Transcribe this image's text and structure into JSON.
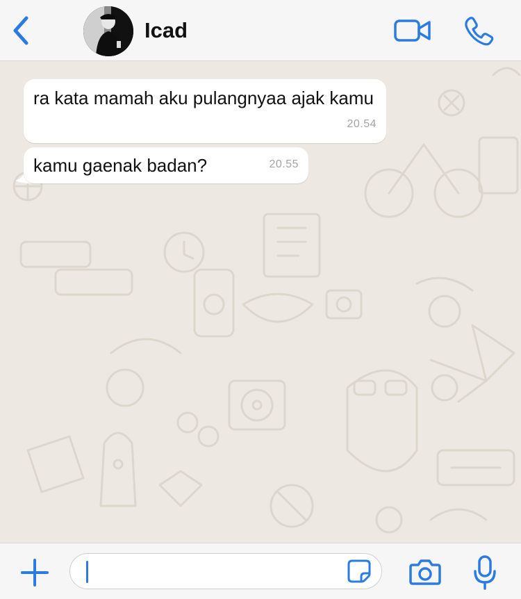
{
  "header": {
    "contact_name": "Icad",
    "accent_color": "#2b7be0"
  },
  "messages": [
    {
      "text": "ra kata mamah aku pulangnyaa ajak kamu",
      "time": "20.54",
      "direction": "incoming"
    },
    {
      "text": "kamu gaenak badan?",
      "time": "20.55",
      "direction": "incoming"
    }
  ],
  "composer": {
    "value": "",
    "placeholder": ""
  },
  "icons": {
    "back": "chevron-left-icon",
    "video": "video-camera-icon",
    "call": "phone-icon",
    "attach": "plus-icon",
    "sticker": "sticker-icon",
    "camera": "camera-icon",
    "mic": "microphone-icon"
  }
}
